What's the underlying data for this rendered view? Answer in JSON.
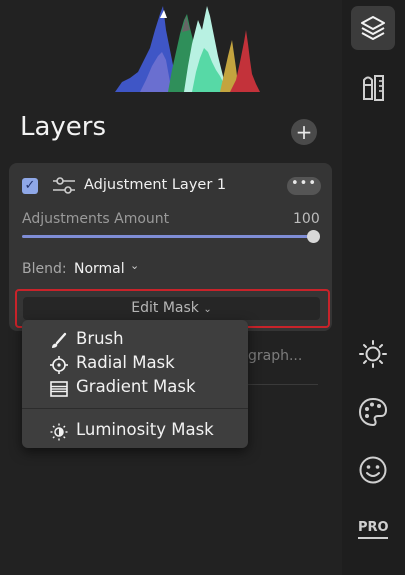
{
  "panel": {
    "title": "Layers"
  },
  "layer": {
    "checked": true,
    "name": "Adjustment Layer 1",
    "amount_label": "Adjustments Amount",
    "amount_value": "100",
    "amount_fraction": 1.0,
    "blend_label": "Blend:",
    "blend_value": "Normal",
    "edit_mask_label": "Edit Mask"
  },
  "behind_text": "graph...",
  "mask_menu": {
    "items": [
      {
        "label": "Brush",
        "icon": "brush-icon"
      },
      {
        "label": "Radial Mask",
        "icon": "radial-mask-icon"
      },
      {
        "label": "Gradient Mask",
        "icon": "gradient-mask-icon"
      },
      {
        "label": "Luminosity Mask",
        "icon": "luminosity-mask-icon"
      }
    ]
  },
  "sidebar": {
    "items": [
      {
        "icon": "layers-icon",
        "active": true
      },
      {
        "icon": "tools-icon",
        "active": false
      },
      {
        "icon": "sun-icon",
        "active": false
      },
      {
        "icon": "palette-icon",
        "active": false
      },
      {
        "icon": "smiley-face-icon",
        "active": false
      },
      {
        "label": "PRO",
        "icon": "pro-badge-icon",
        "active": false
      }
    ]
  },
  "colors": {
    "accent_slider": "#7f8dd6",
    "highlight_border": "#c8232a",
    "checkbox": "#8fa8e8"
  }
}
